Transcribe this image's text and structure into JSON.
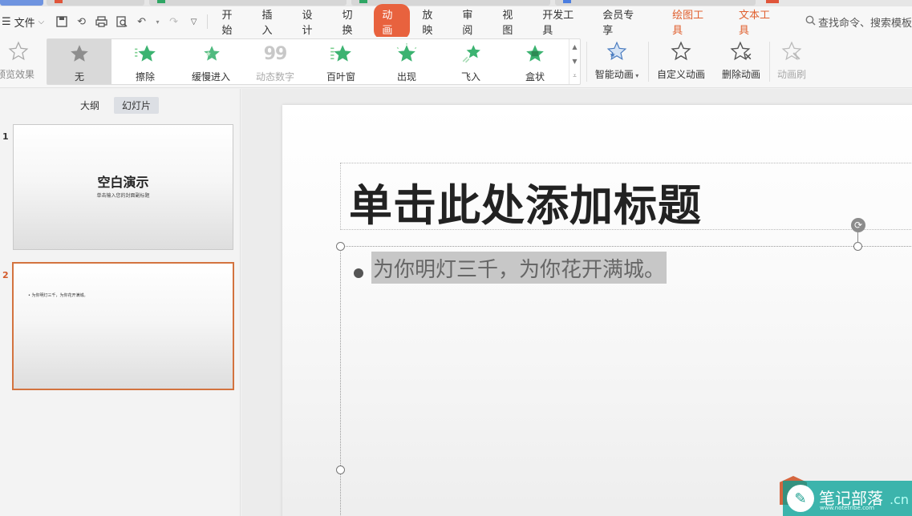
{
  "colors": {
    "accent": "#e8623e",
    "orange_text": "#e0602f",
    "star_green": "#3cb371",
    "selection": "#d3733f"
  },
  "menu": {
    "file_label": "文件",
    "tabs": [
      {
        "label": "开始"
      },
      {
        "label": "插入"
      },
      {
        "label": "设计"
      },
      {
        "label": "切换"
      },
      {
        "label": "动画"
      },
      {
        "label": "放映"
      },
      {
        "label": "审阅"
      },
      {
        "label": "视图"
      },
      {
        "label": "开发工具"
      },
      {
        "label": "会员专享"
      },
      {
        "label": "绘图工具"
      },
      {
        "label": "文本工具"
      }
    ],
    "search_placeholder": "查找命令、搜索模板"
  },
  "ribbon": {
    "preview_label": "预览效果",
    "gallery": [
      {
        "label": "无",
        "icon": "star-gray-icon"
      },
      {
        "label": "擦除",
        "icon": "star-wipe-icon"
      },
      {
        "label": "缓慢进入",
        "icon": "star-slow-icon"
      },
      {
        "label": "动态数字",
        "icon": "dynamic-number-icon"
      },
      {
        "label": "百叶窗",
        "icon": "star-blinds-icon"
      },
      {
        "label": "出现",
        "icon": "star-appear-icon"
      },
      {
        "label": "飞入",
        "icon": "star-fly-icon"
      },
      {
        "label": "盒状",
        "icon": "star-box-icon"
      }
    ],
    "smart_label": "智能动画",
    "custom_label": "自定义动画",
    "delete_label": "删除动画",
    "brush_label": "动画刷"
  },
  "left_pane": {
    "view_tabs": [
      {
        "label": "大纲"
      },
      {
        "label": "幻灯片"
      }
    ],
    "slides": [
      {
        "number": "1",
        "title": "空白演示",
        "subtitle": "单击输入您的封面副标题"
      },
      {
        "number": "2",
        "bullet": "为你明灯三千，为你花开满城。"
      }
    ]
  },
  "slide": {
    "title_placeholder": "单击此处添加标题",
    "body_text": "为你明灯三千，为你花开满城。"
  },
  "watermark": {
    "text": "笔记部落",
    "sub": "www.notetribe.com",
    "tld": ".cn"
  }
}
